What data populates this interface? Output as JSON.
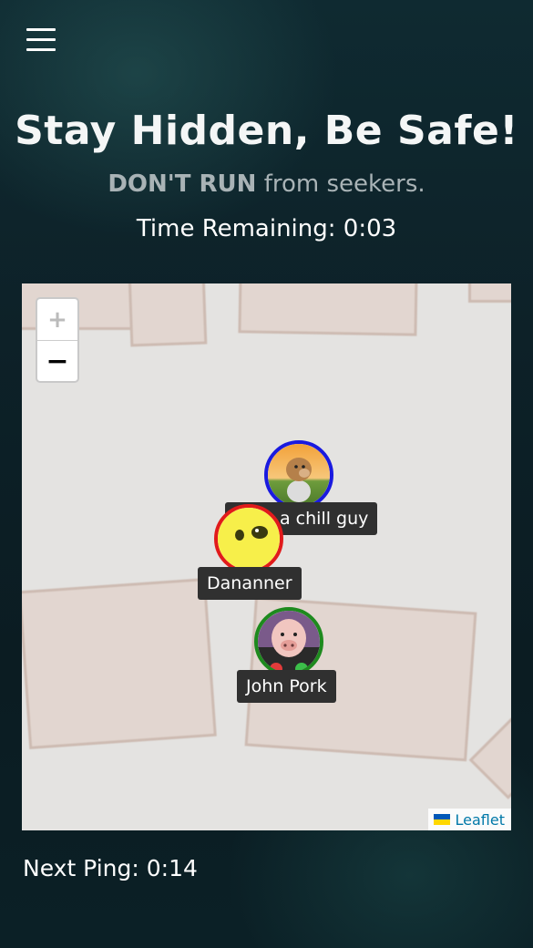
{
  "menu": {
    "icon": "hamburger-menu-icon"
  },
  "header": {
    "title": "Stay Hidden, Be Safe!",
    "subtitle_bold": "DON'T RUN",
    "subtitle_rest": "from seekers.",
    "time_remaining": "Time Remaining: 0:03"
  },
  "map": {
    "zoom_in_label": "+",
    "zoom_out_label": "−",
    "attribution_label": "Leaflet",
    "attribution_icon": "ukraine-flag-icon",
    "players": [
      {
        "name": "a chill guy",
        "ring_color": "#1a1adf",
        "avatar": "chill-guy-avatar"
      },
      {
        "name": "Dananner",
        "ring_color": "#e11b1b",
        "avatar": "yellow-face-avatar"
      },
      {
        "name": "John Pork",
        "ring_color": "#1e8a1e",
        "avatar": "pig-avatar"
      }
    ]
  },
  "footer": {
    "next_ping": "Next Ping: 0:14"
  }
}
